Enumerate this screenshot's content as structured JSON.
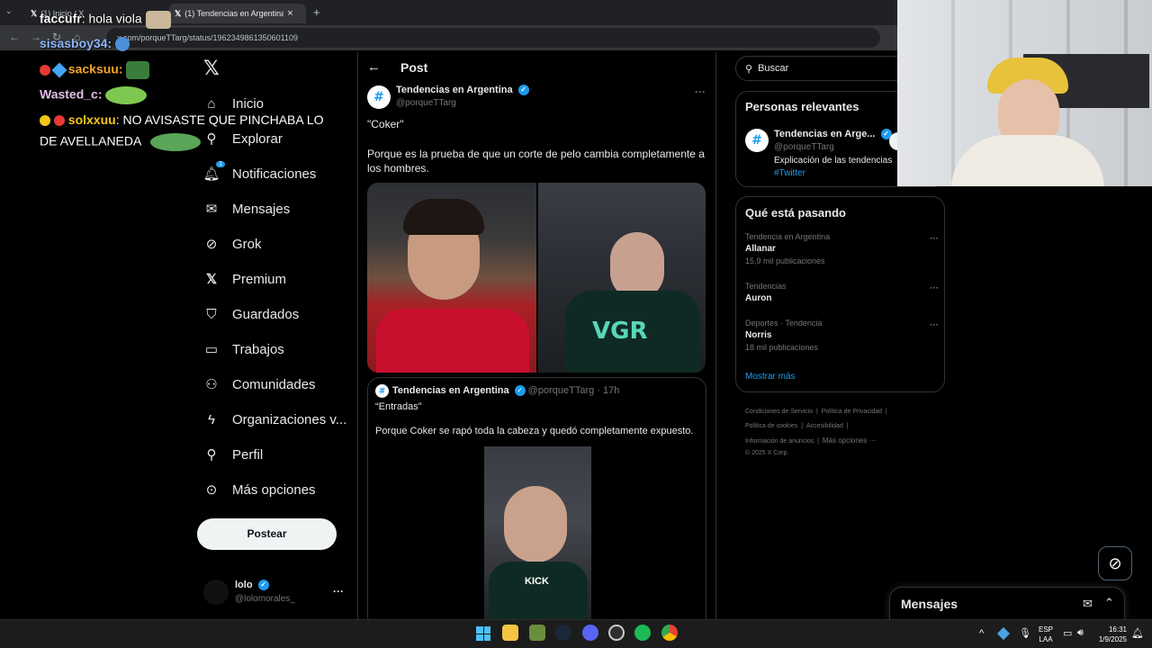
{
  "browser": {
    "tabs": [
      {
        "label": "(1) Inicio / X"
      },
      {
        "label": "(1) Tendencias en Argentina en"
      }
    ],
    "url": "x.com/porqueTTarg/status/1962349861350601109",
    "new_tab": "+",
    "close": "×"
  },
  "sidebar": {
    "items": [
      {
        "label": "Inicio",
        "icon": "home-icon"
      },
      {
        "label": "Explorar",
        "icon": "search-icon"
      },
      {
        "label": "Notificaciones",
        "icon": "bell-icon",
        "badge": "1"
      },
      {
        "label": "Mensajes",
        "icon": "mail-icon"
      },
      {
        "label": "Grok",
        "icon": "grok-icon"
      },
      {
        "label": "Premium",
        "icon": "x-icon"
      },
      {
        "label": "Guardados",
        "icon": "bookmark-icon"
      },
      {
        "label": "Trabajos",
        "icon": "briefcase-icon"
      },
      {
        "label": "Comunidades",
        "icon": "people-icon"
      },
      {
        "label": "Organizaciones v...",
        "icon": "lightning-icon"
      },
      {
        "label": "Perfil",
        "icon": "person-icon"
      },
      {
        "label": "Más opciones",
        "icon": "more-circle-icon"
      }
    ],
    "post_button": "Postear",
    "account": {
      "name": "lolo",
      "handle": "@lolomorales_",
      "more": "···"
    }
  },
  "post": {
    "header": "Post",
    "author": "Tendencias en Argentina",
    "handle": "@porqueTTarg",
    "more": "···",
    "line1": "\"Coker\"",
    "line2": "Porque es la prueba de que un corte de pelo cambia completamente a los hombres.",
    "quote": {
      "author": "Tendencias en Argentina",
      "handle": "@porqueTTarg",
      "time": "· 17h",
      "line1": "“Entradas”",
      "line2": "Porque Coker se rapó toda la cabeza y quedó completamente expuesto.",
      "image_text": "KICK"
    }
  },
  "right": {
    "search_placeholder": "Buscar",
    "relevant": {
      "title": "Personas relevantes",
      "name": "Tendencias en Arge...",
      "handle": "@porqueTTarg",
      "bio": "Explicación de las tendencias",
      "tag": "#Twitter"
    },
    "trending": {
      "title": "Qué está pasando",
      "items": [
        {
          "context": "Tendencia en Argentina",
          "name": "Allanar",
          "count": "15,9 mil publicaciones"
        },
        {
          "context": "Tendencias",
          "name": "Auron",
          "count": ""
        },
        {
          "context": "Deportes · Tendencia",
          "name": "Norris",
          "count": "18 mil publicaciones"
        }
      ],
      "more": "···",
      "show_more": "Mostrar más"
    },
    "footer": {
      "l1": [
        "Condiciones de Servicio",
        "Política de Privacidad"
      ],
      "l2": [
        "Política de cookies",
        "Accesibilidad"
      ],
      "l3": [
        "Información de anuncios",
        "Más opciones ···"
      ],
      "copyright": "© 2025 X Corp."
    },
    "messages": "Mensajes"
  },
  "chat": [
    {
      "user": "faccufr",
      "msg": ": hola viola"
    },
    {
      "user": "sisasboy34",
      "msg": ":"
    },
    {
      "user": "sacksuu",
      "msg": ":"
    },
    {
      "user": "Wasted_c",
      "msg": ":"
    },
    {
      "user": "solxxuu",
      "msg": ": NO AVISASTE QUE PINCHABA LO"
    },
    {
      "user": "",
      "msg": "DE AVELLANEDA"
    }
  ],
  "taskbar": {
    "lang1": "ESP",
    "lang2": "LAA",
    "time": "16:31",
    "date": "1/9/2025",
    "chevron": "^"
  },
  "colors": {
    "accent": "#1d9bf0",
    "bg": "#000000",
    "border": "#2f3336"
  }
}
